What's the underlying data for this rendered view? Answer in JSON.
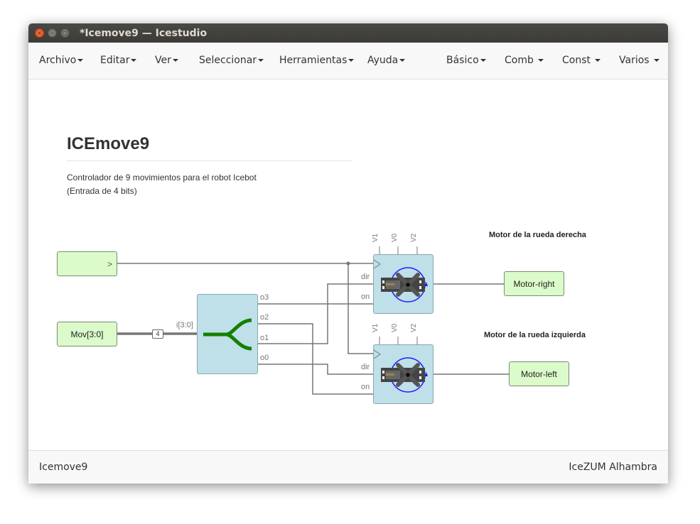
{
  "window": {
    "title": "*Icemove9 — Icestudio",
    "buttons": {
      "close": "×",
      "minimize": "–",
      "maximize": "□"
    }
  },
  "menubar": {
    "left": [
      "Archivo",
      "Editar",
      "Ver",
      "Seleccionar",
      "Herramientas",
      "Ayuda"
    ],
    "right": [
      "Básico",
      "Comb",
      "Const",
      "Varios"
    ]
  },
  "info": {
    "title": "ICEmove9",
    "line1": "Controlador de 9 movimientos para el robot Icebot",
    "line2": "(Entrada de 4 bits)"
  },
  "circuit": {
    "clk_input_symbol": ">",
    "mov_input_label": "Mov[3:0]",
    "bus_width": "4",
    "splitter_input": "i[3:0]",
    "splitter_outputs": [
      "o3",
      "o2",
      "o1",
      "o0"
    ],
    "servo_params": [
      "V1",
      "V0",
      "V2"
    ],
    "servo_inputs": [
      "dir",
      "on"
    ],
    "servo_image_text": "Servo",
    "comment_right": "Motor de la rueda derecha",
    "comment_left": "Motor de la rueda izquierda",
    "output_right": "Motor-right",
    "output_left": "Motor-left",
    "colors": {
      "input_fill": "#dcfbca",
      "block_fill": "#bfdfe9",
      "splitter_icon": "#138000",
      "wire": "#777777",
      "servo_ring": "#1a1aff"
    }
  },
  "footer": {
    "project": "Icemove9",
    "board": "IceZUM Alhambra"
  }
}
